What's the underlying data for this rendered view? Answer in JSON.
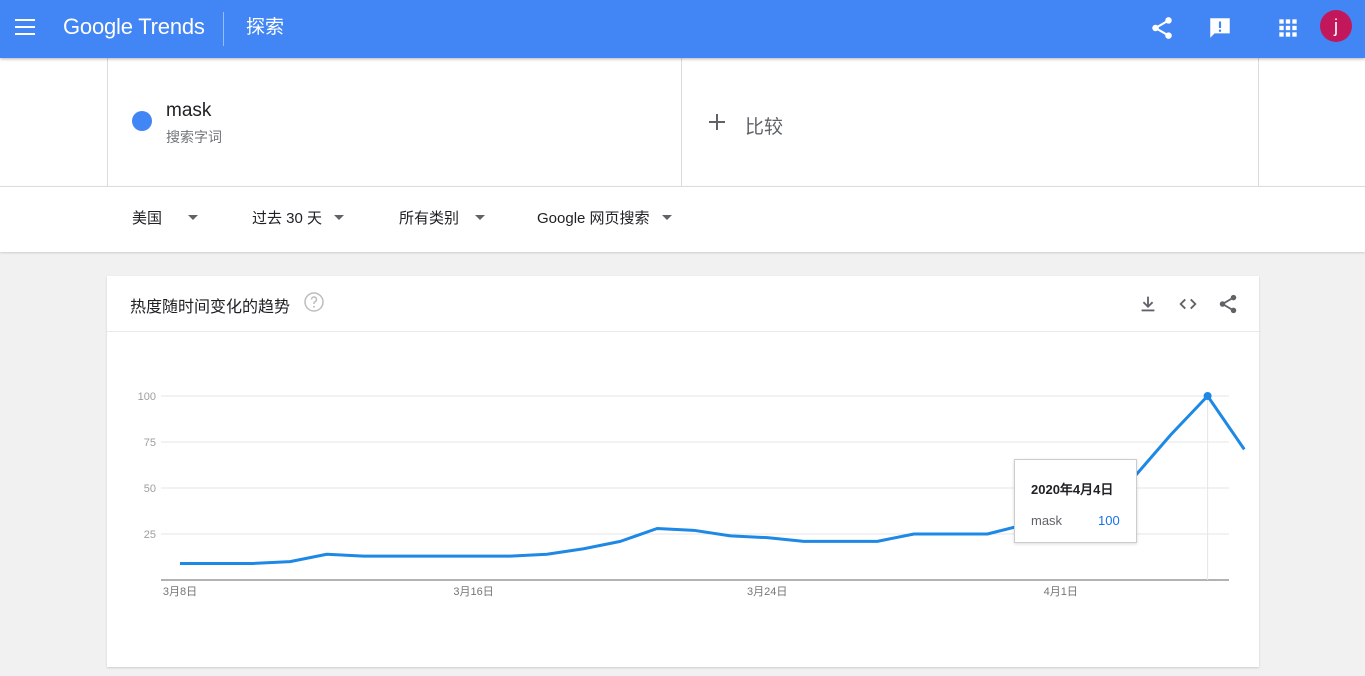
{
  "topbar": {
    "logo_text": "Google Trends",
    "section_title": "探索",
    "avatar_letter": "j",
    "colors": {
      "bar": "#4285f4",
      "avatar": "#c2185b"
    }
  },
  "term": {
    "name": "mask",
    "type": "搜索字词",
    "color": "#4285f4"
  },
  "compare": {
    "label": "比较"
  },
  "filters": {
    "region": "美国",
    "time_range": "过去 30 天",
    "category": "所有类别",
    "search_type": "Google 网页搜索"
  },
  "card": {
    "title": "热度随时间变化的趋势",
    "icons": [
      "help-icon",
      "download-icon",
      "embed-icon",
      "share-icon"
    ]
  },
  "tooltip": {
    "date": "2020年4月4日",
    "term": "mask",
    "value": "100"
  },
  "chart_data": {
    "type": "line",
    "y_ticks": [
      100,
      75,
      50,
      25
    ],
    "x_ticks": [
      {
        "label": "3月8日",
        "day": 0
      },
      {
        "label": "3月16日",
        "day": 8
      },
      {
        "label": "3月24日",
        "day": 16
      },
      {
        "label": "4月1日",
        "day": 24
      }
    ],
    "ylim": [
      0,
      100
    ],
    "grid": true,
    "series": [
      {
        "name": "mask",
        "color": "#1e88e5",
        "values": [
          9,
          9,
          9,
          10,
          14,
          13,
          13,
          13,
          13,
          13,
          14,
          17,
          21,
          28,
          27,
          24,
          23,
          21,
          21,
          21,
          25,
          25,
          25,
          30,
          36,
          44,
          56,
          79,
          100,
          71
        ]
      }
    ],
    "highlight_index": 27
  }
}
